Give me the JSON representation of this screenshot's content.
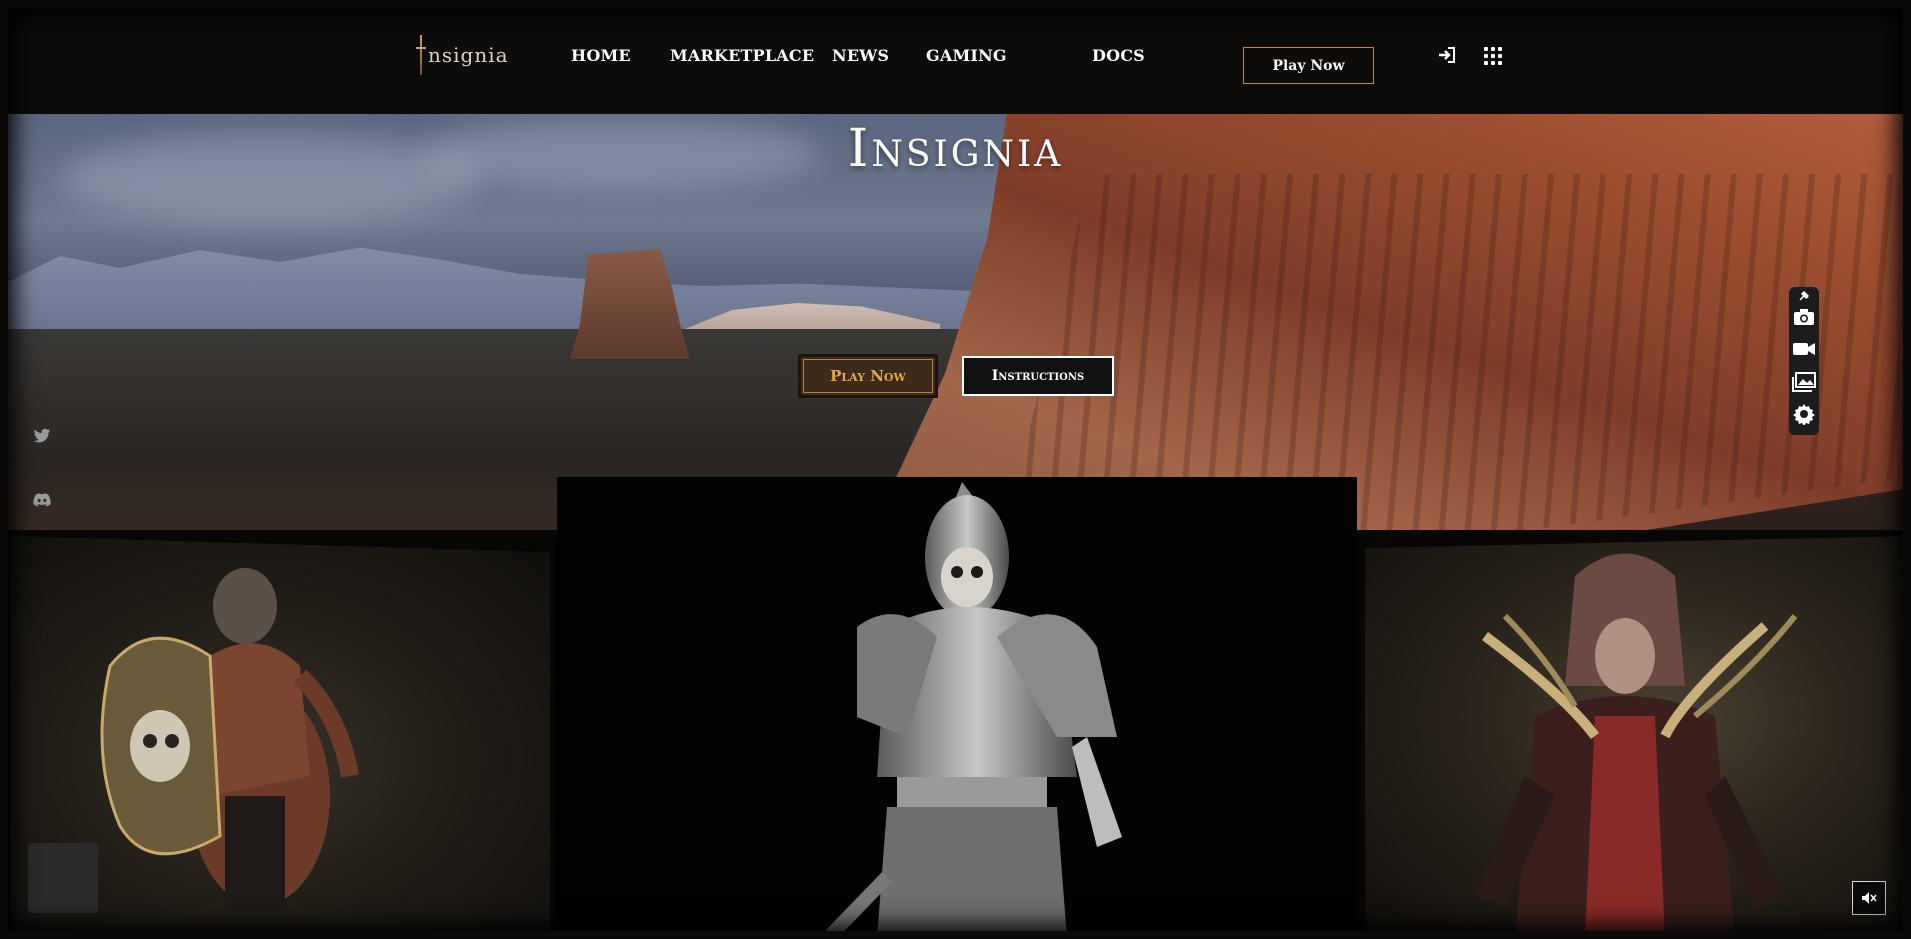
{
  "brand": {
    "logo_text": "nsignia"
  },
  "nav": {
    "home": "HOME",
    "marketplace": "MARKETPLACE",
    "news": "NEWS",
    "gaming": "GAMING",
    "docs": "DOCS",
    "play_now": "Play Now"
  },
  "hero": {
    "title": "Insignia",
    "play_button": "Play Now",
    "instructions_button": "Instructions"
  },
  "icons": {
    "login": "login-icon",
    "apps": "apps-grid-icon",
    "twitter": "twitter-icon",
    "discord": "discord-icon",
    "pin": "pin-icon",
    "camera": "camera-icon",
    "video": "video-camera-icon",
    "gallery": "gallery-icon",
    "settings": "gear-icon",
    "mute": "speaker-muted-icon"
  },
  "colors": {
    "header_bg": "#0d0c0b",
    "accent_gold": "#e4a947",
    "button_border_gold": "#c08a3a"
  }
}
